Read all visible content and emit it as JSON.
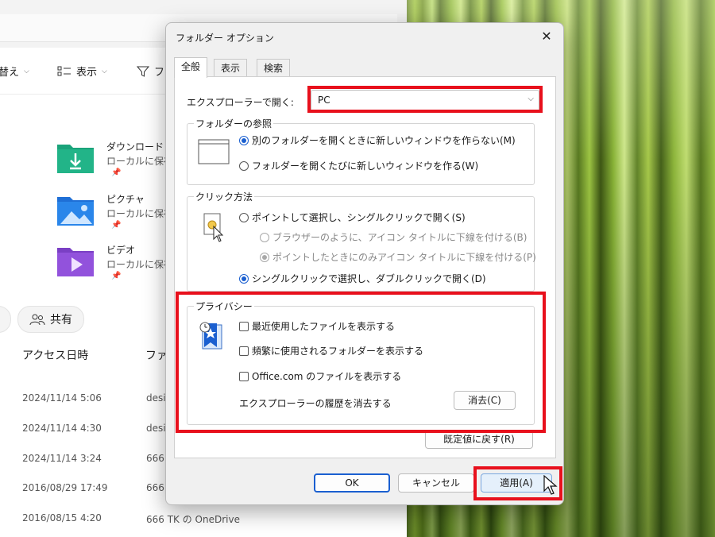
{
  "explorer": {
    "address_text": "",
    "toolbar": {
      "sort_label": "替え",
      "view_label": "表示",
      "filter_label": "フ"
    },
    "quick_access": [
      {
        "title": "ダウンロード",
        "subtitle": "ローカルに保存"
      },
      {
        "title": "ピクチャ",
        "subtitle": "ローカルに保存"
      },
      {
        "title": "ビデオ",
        "subtitle": "ローカルに保存"
      }
    ],
    "share_label": "共有",
    "columns": {
      "date": "アクセス日時",
      "file": "ファ"
    },
    "recent": [
      {
        "date": "2024/11/14 5:06",
        "loc": "desi"
      },
      {
        "date": "2024/11/14 4:30",
        "loc": "desi"
      },
      {
        "date": "2024/11/14 3:24",
        "loc": "666"
      },
      {
        "date": "2016/08/29 17:49",
        "loc": "666"
      },
      {
        "date": "2016/08/15 4:20",
        "loc": "666 TK の OneDrive"
      }
    ]
  },
  "dialog": {
    "title": "フォルダー オプション",
    "close_symbol": "✕",
    "tabs": [
      "全般",
      "表示",
      "検索"
    ],
    "open_with_label": "エクスプローラーで開く:",
    "open_with_value": "PC",
    "browse_group": {
      "title": "フォルダーの参照",
      "options": [
        "別のフォルダーを開くときに新しいウィンドウを作らない(M)",
        "フォルダーを開くたびに新しいウィンドウを作る(W)"
      ]
    },
    "click_group": {
      "title": "クリック方法",
      "options": [
        "ポイントして選択し、シングルクリックで開く(S)",
        "ブラウザーのように、アイコン タイトルに下線を付ける(B)",
        "ポイントしたときにのみアイコン タイトルに下線を付ける(P)",
        "シングルクリックで選択し、ダブルクリックで開く(D)"
      ]
    },
    "privacy_group": {
      "title": "プライバシー",
      "checks": [
        "最近使用したファイルを表示する",
        "頻繁に使用されるフォルダーを表示する",
        "Office.com のファイルを表示する"
      ],
      "clear_label": "エクスプローラーの履歴を消去する",
      "clear_button": "消去(C)"
    },
    "restore_button": "既定値に戻す(R)",
    "ok_button": "OK",
    "cancel_button": "キャンセル",
    "apply_button": "適用(A)"
  },
  "colors": {
    "highlight": "#e8101c",
    "accent": "#1a5fd0"
  }
}
